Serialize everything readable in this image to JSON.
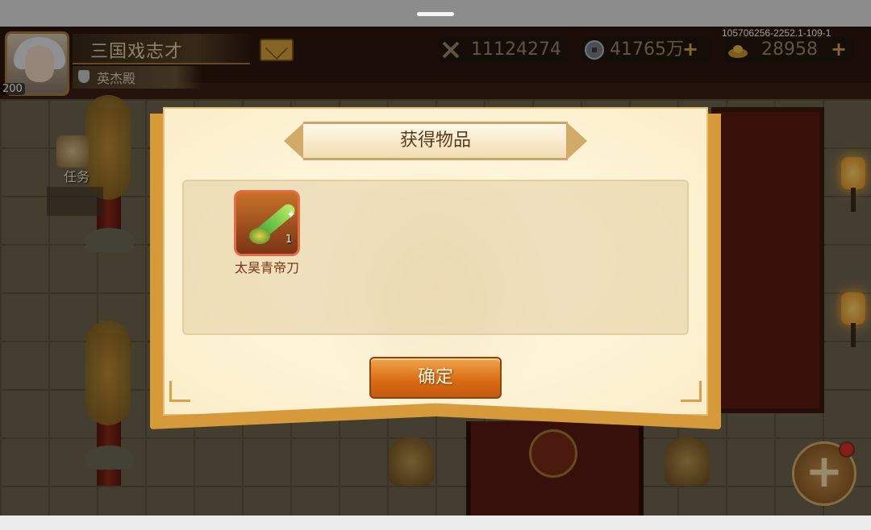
{
  "hud": {
    "player_name": "三国戏志才",
    "guild_name": "英杰殿",
    "level": "200",
    "power": "11124274",
    "silver": "41765万",
    "gold": "28958",
    "build_id": "105706256-2252.1-109-1",
    "icons": [
      "avatar",
      "shield-icon",
      "mail-icon",
      "sword-icon",
      "coin-icon",
      "ingot-icon",
      "plus-icon"
    ]
  },
  "side": {
    "quest_label": "任务"
  },
  "dialog": {
    "title": "获得物品",
    "items": [
      {
        "name": "太昊青帝刀",
        "count": "1",
        "icon": "sword-item-icon"
      }
    ],
    "confirm_label": "确定"
  },
  "colors": {
    "accent": "#d76a14",
    "paper": "#fbedc8",
    "item_border": "#e56a46"
  }
}
